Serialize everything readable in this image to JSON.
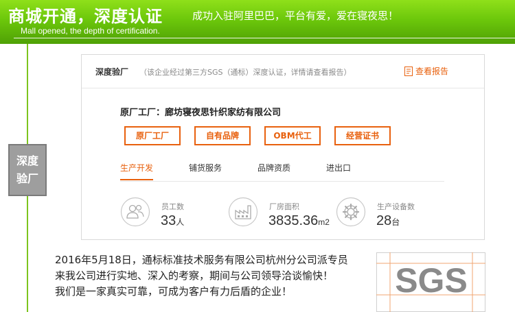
{
  "banner": {
    "title": "商城开通，深度认证",
    "slogan": "成功入驻阿里巴巴，平台有爱，爱在寝夜思！",
    "subtitle": "Mall opened, the depth of certification."
  },
  "side_badge": {
    "line1": "深度",
    "line2": "验厂"
  },
  "card": {
    "title": "深度验厂",
    "note": "（该企业经过第三方SGS（通标）深度认证，详情请查看报告）",
    "report_link": "查看报告",
    "factory_label": "原厂工厂：",
    "factory_name": "廊坊寝夜思针织家纺有限公司",
    "buttons": [
      "原厂工厂",
      "自有品牌",
      "OBM代工",
      "经营证书"
    ],
    "tabs": [
      "生产开发",
      "铺货服务",
      "品牌资质",
      "进出口"
    ],
    "active_tab": "生产开发",
    "stats": [
      {
        "icon": "employees-icon",
        "label": "员工数",
        "value": "33",
        "unit": "人"
      },
      {
        "icon": "factory-icon",
        "label": "厂房面积",
        "value": "3835.36",
        "unit": "m2"
      },
      {
        "icon": "equipment-icon",
        "label": "生产设备数",
        "value": "28",
        "unit": "台"
      }
    ]
  },
  "bottom": {
    "lines": [
      "2016年5月18日，通标标准技术服务有限公司杭州分公司派专员",
      "来我公司进行实地、深入的考察，期间与公司领导洽谈愉快！",
      "我们是一家真实可靠，可成为客户有力后盾的企业！"
    ],
    "sgs_logo": "SGS"
  },
  "colors": {
    "green": "#6cc70b",
    "accent": "#e8600d",
    "gray_badge": "#9e9e9e"
  }
}
